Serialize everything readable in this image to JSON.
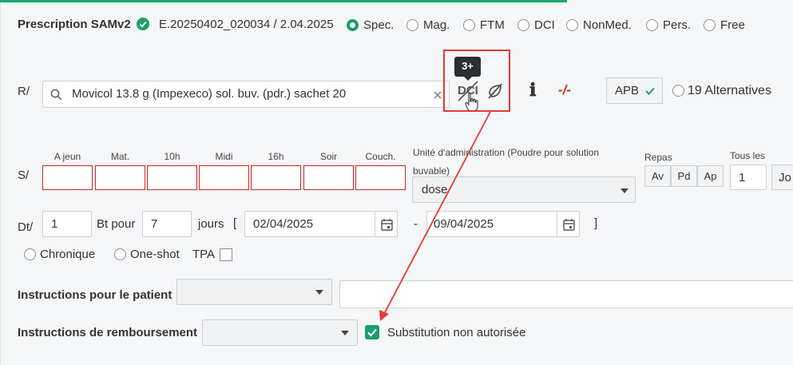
{
  "header": {
    "title": "Prescription SAMv2",
    "code": "E.20250402_020034 / 2.04.2025",
    "types": [
      {
        "label": "Spec.",
        "selected": true
      },
      {
        "label": "Mag.",
        "selected": false
      },
      {
        "label": "FTM",
        "selected": false
      },
      {
        "label": "DCI",
        "selected": false
      },
      {
        "label": "NonMed.",
        "selected": false
      },
      {
        "label": "Pers.",
        "selected": false
      },
      {
        "label": "Free",
        "selected": false
      }
    ]
  },
  "prescription": {
    "label": "R/",
    "search_value": "Movicol 13.8 g (Impexeco) sol. buv. (pdr.) sachet 20",
    "badge": "3+",
    "dci_text": "DCI",
    "dash_text": "-/-",
    "apb_label": "APB",
    "alternatives_label": "19 Alternatives"
  },
  "schedule": {
    "label": "S/",
    "columns": [
      "A jeun",
      "Mat.",
      "10h",
      "Midi",
      "16h",
      "Soir",
      "Couch."
    ],
    "unit_label": "Unité d'administration  (Poudre pour solution buvable)",
    "unit_value": "dose",
    "repas_label": "Repas",
    "repas_buttons": [
      "Av",
      "Pd",
      "Ap"
    ],
    "tous_les_label": "Tous les",
    "tous_les_value": "1",
    "period_button": "Jo"
  },
  "duration": {
    "label": "Dt/",
    "quantity": "1",
    "bt_pour_label": "Bt pour",
    "days_value": "7",
    "jours_label": "jours",
    "open_bracket": "[",
    "start_date": "02/04/2025",
    "dash": "-",
    "end_date": "09/04/2025",
    "close_bracket": "]"
  },
  "options": {
    "chronique_label": "Chronique",
    "oneshot_label": "One-shot",
    "tpa_label": "TPA"
  },
  "instructions": {
    "patient_label": "Instructions pour le patient",
    "reimbursement_label": "Instructions de remboursement",
    "substitution_label": "Substitution non autorisée",
    "substitution_checked": true
  },
  "colors": {
    "accent": "#1a9e6a",
    "annotation_red": "#e53935",
    "invalid_border": "#c62828"
  }
}
